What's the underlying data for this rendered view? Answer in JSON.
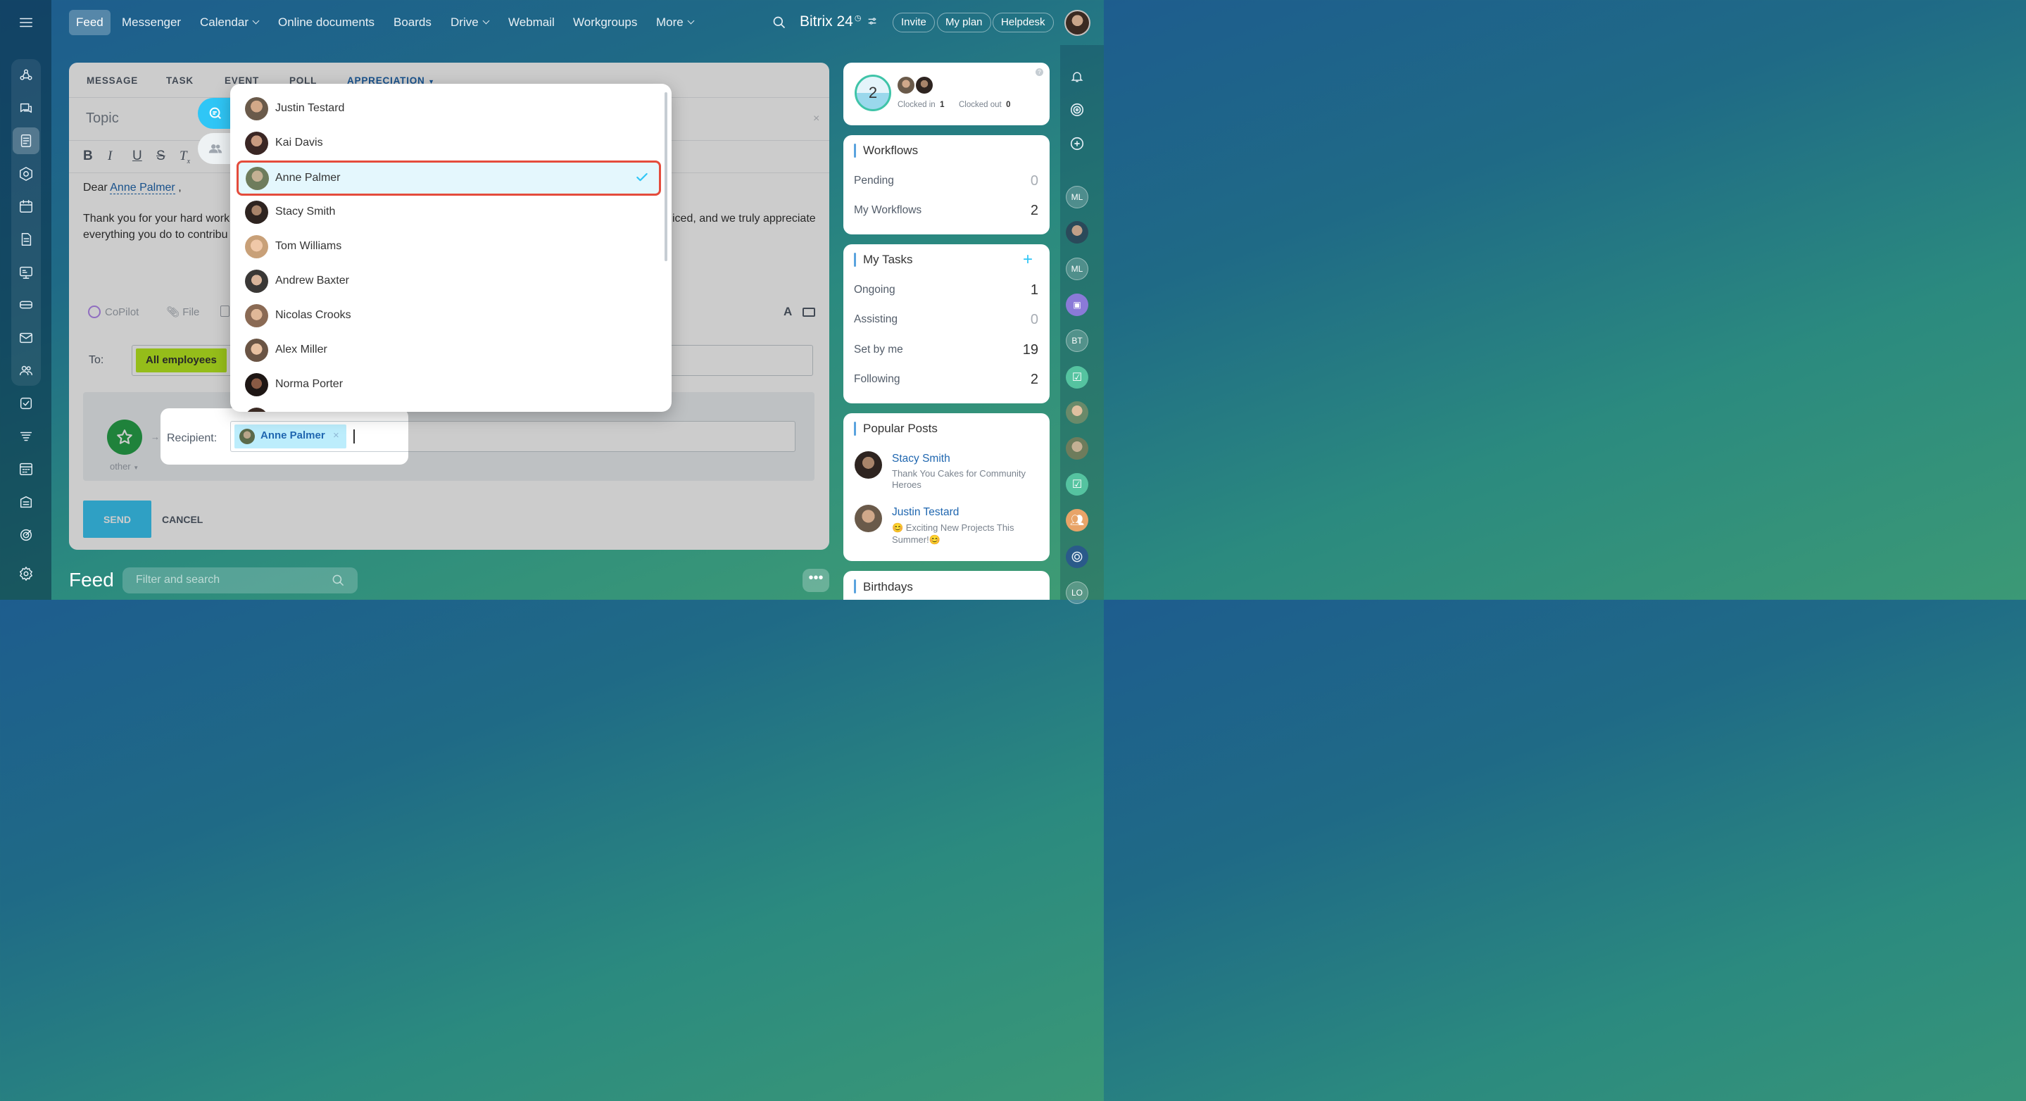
{
  "topnav": {
    "items": [
      {
        "label": "Feed",
        "active": true
      },
      {
        "label": "Messenger"
      },
      {
        "label": "Calendar",
        "dropdown": true
      },
      {
        "label": "Online documents"
      },
      {
        "label": "Boards"
      },
      {
        "label": "Drive",
        "dropdown": true
      },
      {
        "label": "Webmail"
      },
      {
        "label": "Workgroups"
      },
      {
        "label": "More",
        "dropdown": true
      }
    ],
    "brand": "Bitrix 24",
    "invite": "Invite",
    "my_plan": "My plan",
    "helpdesk": "Helpdesk"
  },
  "composer": {
    "tabs": [
      "MESSAGE",
      "TASK",
      "EVENT",
      "POLL",
      "APPRECIATION"
    ],
    "topic_placeholder": "Topic",
    "salutation": "Dear",
    "mention": "Anne Palmer",
    "salutation_end": ",",
    "body_left_1": "Thank you for your hard work",
    "body_right_1": "iced, and we truly appreciate",
    "body_left_2": "everything you do to contribu",
    "copilot": "CoPilot",
    "file": "File",
    "to_label": "To:",
    "to_chip": "All employees",
    "badge_label": "other",
    "recipient_label": "Recipient:",
    "recipient_chip": "Anne Palmer",
    "send": "SEND",
    "cancel": "CANCEL"
  },
  "feed": {
    "title": "Feed",
    "search_placeholder": "Filter and search"
  },
  "dropdown": {
    "items": [
      {
        "name": "Justin Testard",
        "color": "#8a7660"
      },
      {
        "name": "Kai Davis",
        "color": "#5a3a34"
      },
      {
        "name": "Anne Palmer",
        "color": "#7c8a6a",
        "selected": true
      },
      {
        "name": "Stacy Smith",
        "color": "#4a3b32"
      },
      {
        "name": "Tom Williams",
        "color": "#c8a88a"
      },
      {
        "name": "Andrew Baxter",
        "color": "#4d4a48"
      },
      {
        "name": "Nicolas Crooks",
        "color": "#a8806a"
      },
      {
        "name": "Alex Miller",
        "color": "#9a7a62"
      },
      {
        "name": "Norma Porter",
        "color": "#3a2a24"
      }
    ],
    "selected_color": "#e44c3c"
  },
  "timeman": {
    "count": "2",
    "clocked_in_label": "Clocked in",
    "clocked_in": "1",
    "clocked_out_label": "Clocked out",
    "clocked_out": "0"
  },
  "workflows": {
    "title": "Workflows",
    "rows": [
      {
        "label": "Pending",
        "value": "0"
      },
      {
        "label": "My Workflows",
        "value": "2"
      }
    ]
  },
  "tasks": {
    "title": "My Tasks",
    "rows": [
      {
        "label": "Ongoing",
        "value": "1"
      },
      {
        "label": "Assisting",
        "value": "0"
      },
      {
        "label": "Set by me",
        "value": "19"
      },
      {
        "label": "Following",
        "value": "2"
      }
    ]
  },
  "popular": {
    "title": "Popular Posts",
    "posts": [
      {
        "author": "Stacy Smith",
        "text": "Thank You Cakes for Community Heroes"
      },
      {
        "author": "Justin Testard",
        "text": "😊 Exciting New Projects This Summer!😊"
      }
    ]
  },
  "birthdays": {
    "title": "Birthdays"
  },
  "rightbar": {
    "initials": [
      "ML",
      "ML",
      "BT",
      "LO"
    ]
  },
  "colors": {
    "accent": "#2fc6f6",
    "send": "#3bc8f5",
    "chip_green": "#bbed21",
    "link": "#2067b0",
    "star": "#27a34a"
  }
}
